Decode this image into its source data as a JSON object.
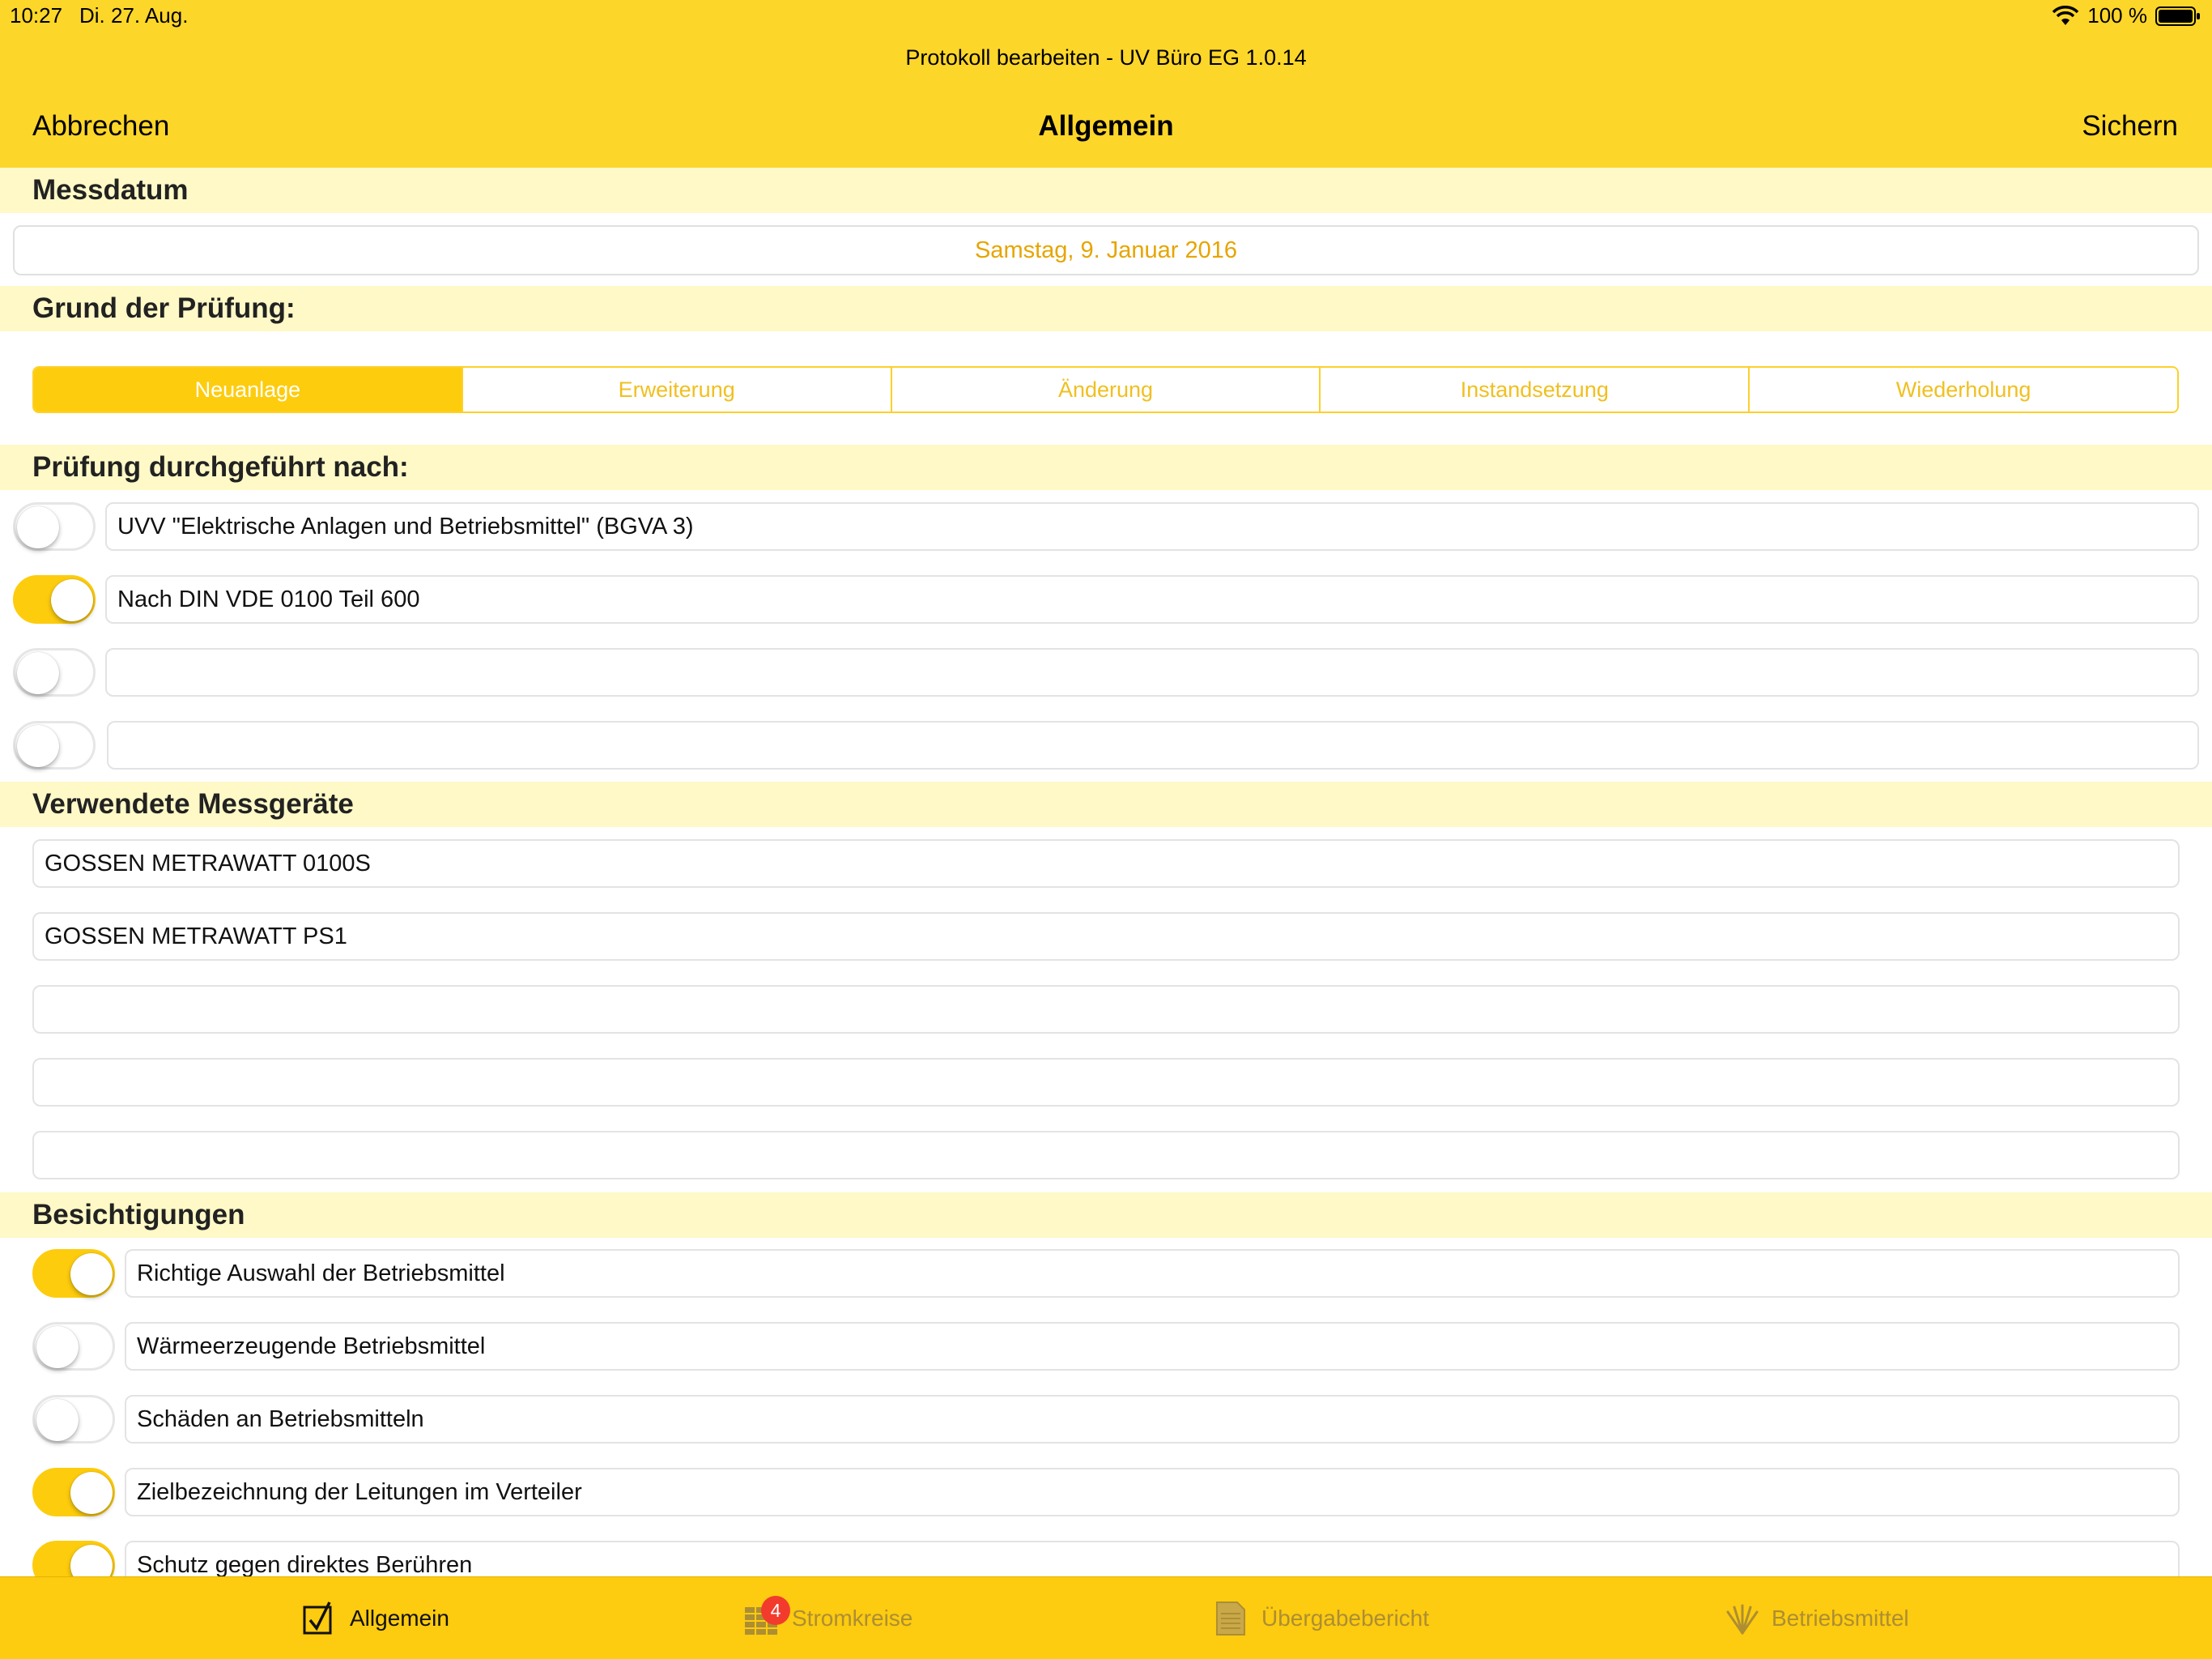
{
  "status_bar": {
    "time": "10:27",
    "date": "Di. 27. Aug.",
    "battery": "100 %"
  },
  "window_title": "Protokoll bearbeiten - UV Büro EG 1.0.14",
  "nav": {
    "cancel_label": "Abbrechen",
    "title": "Allgemein",
    "save_label": "Sichern"
  },
  "messdatum": {
    "header": "Messdatum",
    "value": "Samstag, 9. Januar 2016"
  },
  "grund": {
    "header": "Grund der Prüfung:",
    "options": [
      "Neuanlage",
      "Erweiterung",
      "Änderung",
      "Instandsetzung",
      "Wiederholung"
    ],
    "selected": "Neuanlage"
  },
  "pruefung": {
    "header": "Prüfung durchgeführt nach:",
    "items": [
      {
        "label": "UVV \"Elektrische Anlagen und Betriebsmittel\" (BGVA 3)",
        "on": false
      },
      {
        "label": "Nach DIN VDE 0100 Teil 600",
        "on": true
      },
      {
        "label": "",
        "on": false
      },
      {
        "label": "",
        "on": false
      }
    ]
  },
  "messgeraete": {
    "header": "Verwendete Messgeräte",
    "items": [
      "GOSSEN METRAWATT 0100S",
      "GOSSEN METRAWATT PS1",
      "",
      "",
      ""
    ]
  },
  "besichtigungen": {
    "header": "Besichtigungen",
    "items": [
      {
        "label": "Richtige Auswahl der Betriebsmittel",
        "on": true
      },
      {
        "label": "Wärmeerzeugende Betriebsmittel",
        "on": false
      },
      {
        "label": "Schäden an Betriebsmitteln",
        "on": false
      },
      {
        "label": "Zielbezeichnung der Leitungen im Verteiler",
        "on": true
      },
      {
        "label": "Schutz gegen direktes Berühren",
        "on": true
      }
    ]
  },
  "tabbar": {
    "tabs": [
      {
        "label": "Allgemein",
        "icon": "checkbox-icon",
        "active": true
      },
      {
        "label": "Stromkreise",
        "icon": "grid-icon",
        "active": false,
        "badge": "4"
      },
      {
        "label": "Übergabebericht",
        "icon": "document-icon",
        "active": false
      },
      {
        "label": "Betriebsmittel",
        "icon": "spark-icon",
        "active": false
      }
    ]
  },
  "colors": {
    "accent": "#fdd62a",
    "section_bg": "#fef9c6",
    "date_text": "#e6a500",
    "badge": "#f23b2d"
  }
}
